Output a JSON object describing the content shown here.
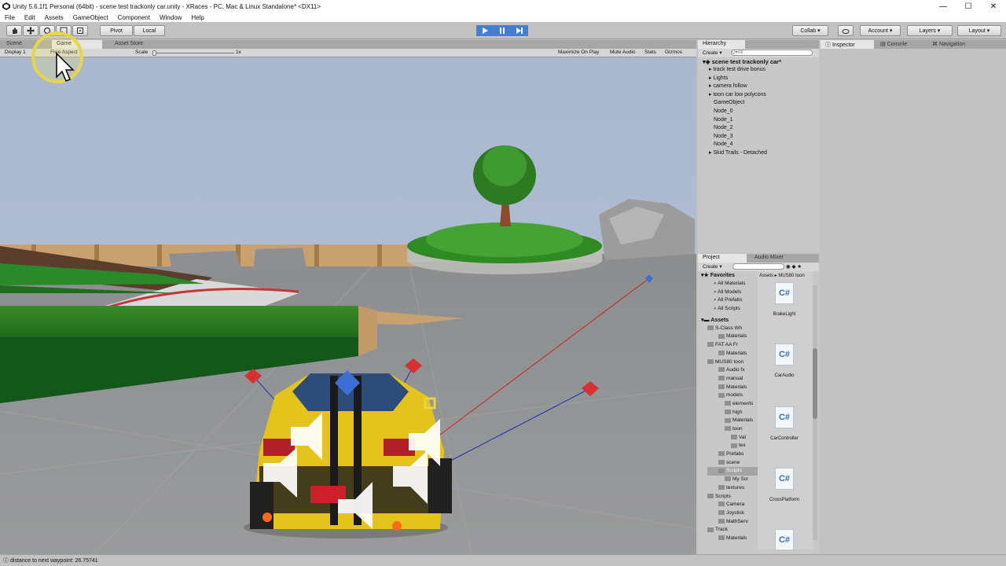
{
  "window": {
    "title": "Unity 5.6.1f1 Personal (64bit) - scene test trackonly car.unity - XRaces - PC, Mac & Linux Standalone* <DX11>",
    "controls": [
      "—",
      "☐",
      "✕"
    ]
  },
  "menu": [
    "File",
    "Edit",
    "Assets",
    "GameObject",
    "Component",
    "Window",
    "Help"
  ],
  "toolbar": {
    "pivot_label": "Pivot",
    "local_label": "Local",
    "collab_label": "Collab ▾",
    "account_label": "Account ▾",
    "layers_label": "Layers ▾",
    "layout_label": "Layout ▾"
  },
  "scene_tabs": [
    "Scene",
    "Game",
    "Asset Store"
  ],
  "game_bar": {
    "display": "Display 1",
    "aspect": "Free Aspect",
    "scale_label": "Scale",
    "scale_value": "1x",
    "maximize": "Maximize On Play",
    "mute": "Mute Audio",
    "stats": "Stats",
    "gizmos": "Gizmos"
  },
  "hierarchy": {
    "tab": "Hierarchy",
    "create": "Create ▾",
    "search_placeholder": "Q▾All",
    "scene_name": "scene test trackonly car*",
    "items": [
      "track test drive bonus",
      "Lights",
      "camera follow",
      "toon car low polycons",
      "GameObject",
      "Node_0",
      "Node_1",
      "Node_2",
      "Node_3",
      "Node_4",
      "Skid Trails - Detached"
    ]
  },
  "inspector_tabs": [
    "Inspector",
    "Console",
    "Navigation"
  ],
  "project": {
    "tabs": [
      "Project",
      "Audio Mixer"
    ],
    "create": "Create ▾",
    "breadcrumb": "Assets ▸ MUS80 toon",
    "favorites_label": "Favorites",
    "favorites": [
      "All Materials",
      "All Models",
      "All Prefabs",
      "All Scripts"
    ],
    "assets_label": "Assets",
    "tree": [
      "S-Class Wh",
      "Materials",
      "FAT AA Fr",
      "Materials",
      "MUS80 toon",
      "Audio fx",
      "manual",
      "Materials",
      "models",
      "elements",
      "high",
      "Materials",
      "toon",
      "Val",
      "tex",
      "Prefabs",
      "scene",
      "Scripts",
      "My Scr",
      "textures",
      "Scripts",
      "Camera",
      "Joystick",
      "MathServ",
      "Track",
      "Materials"
    ],
    "asset_files": [
      "BrakeLight",
      "CarAudio",
      "CarController",
      "CrossPlatform",
      ""
    ]
  },
  "status_text": "distance to next waypoint: 26.75741"
}
